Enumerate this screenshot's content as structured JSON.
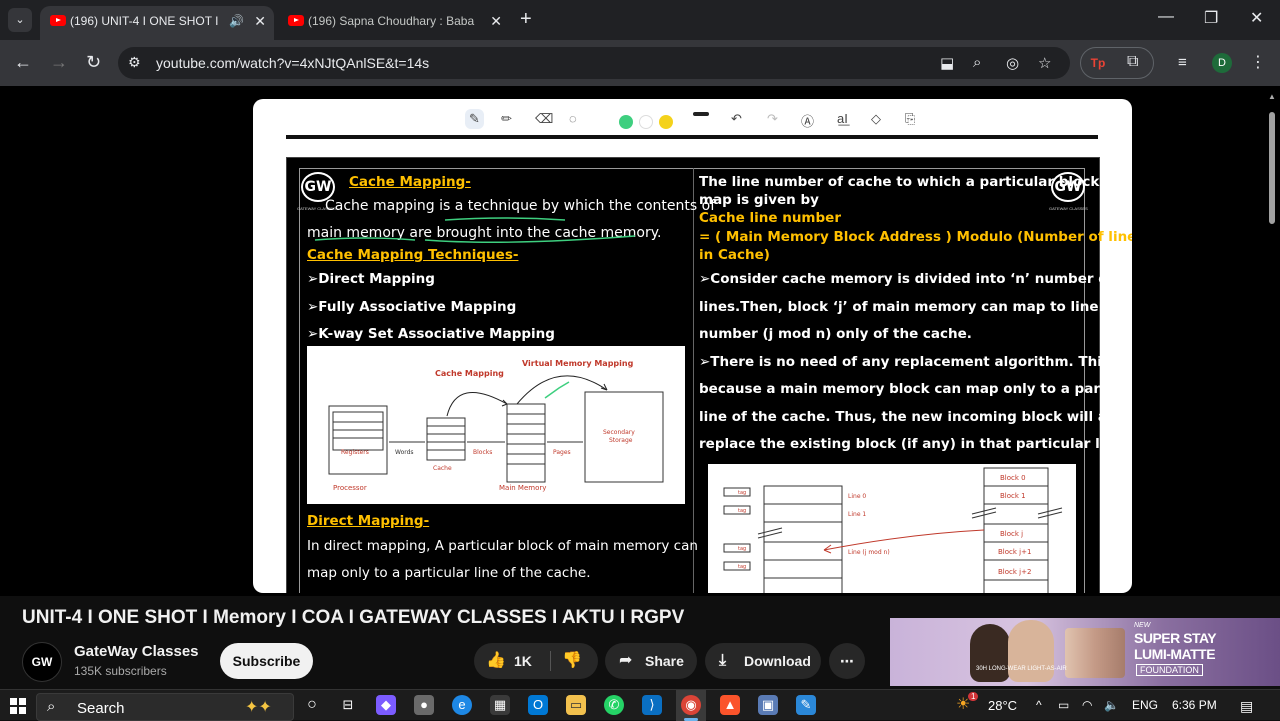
{
  "browser": {
    "tabs": [
      {
        "title": "(196) UNIT-4 I ONE SHOT I",
        "active": true
      },
      {
        "title": "(196) Sapna Choudhary : Baba",
        "active": false
      }
    ],
    "url": "youtube.com/watch?v=4xNJtQAnlSE&t=14s",
    "profile_initial": "D"
  },
  "slide": {
    "left": {
      "heading": "Cache Mapping-",
      "intro_line1": "Cache mapping is a technique by which the contents of",
      "intro_line2": "main memory are brought into the cache memory.",
      "techniques_heading": "Cache Mapping Techniques-",
      "techniques": [
        "➢Direct Mapping",
        "➢Fully Associative Mapping",
        "➢K-way Set Associative Mapping"
      ],
      "direct_heading": "Direct Mapping-",
      "direct_line1": "In direct mapping, A particular block of main memory can",
      "direct_line2": "map only to a particular line of the cache."
    },
    "right": {
      "line1": "The line number of cache to which a particular block can",
      "line2": "map is given by",
      "formula_label": "Cache line number",
      "formula_line1": "= ( Main Memory Block Address ) Modulo (Number of lines",
      "formula_line2": "in Cache)",
      "p1_line1": "➢Consider cache memory is divided into ‘n’ number of",
      "p1_line2": "lines.Then, block ‘j’ of main memory can map to line",
      "p1_line3": "number (j mod n) only of the cache.",
      "p2_line1": "➢There is no need of any replacement algorithm. This is",
      "p2_line2": "because a main memory block can map only to a particular",
      "p2_line3": "line of the cache. Thus, the new incoming block will always",
      "p2_line4": "replace the existing block (if any) in that particular line."
    },
    "logo_text": "GW",
    "logo_sub": "GATEWAY CLASSES",
    "diagram1": {
      "virtual": "Virtual Memory Mapping",
      "cache_mapping": "Cache Mapping",
      "registers": "Registers",
      "words": "Words",
      "blocks": "Blocks",
      "pages": "Pages",
      "secondary": "Secondary",
      "storage": "Storage",
      "cache": "Cache",
      "processor": "Processor",
      "main_memory": "Main Memory"
    },
    "diagram2": {
      "tag": "tag",
      "line0": "Line 0",
      "line1": "Line 1",
      "linej": "Line (j mod n)",
      "block0": "Block 0",
      "block1": "Block 1",
      "blockj": "Block j",
      "blockj1": "Block j+1",
      "blockj2": "Block j+2"
    }
  },
  "video": {
    "title": "UNIT-4 I ONE SHOT I Memory I COA I GATEWAY CLASSES I AKTU I RGPV",
    "channel": "GateWay Classes",
    "subscribers": "135K subscribers",
    "subscribe_label": "Subscribe",
    "likes": "1K",
    "share_label": "Share",
    "download_label": "Download"
  },
  "ad": {
    "new": "NEW",
    "line1": "SUPER STAY",
    "line2": "LUMI-MATTE",
    "line3": "FOUNDATION",
    "small": "30H LONG-WEAR LIGHT-AS-AIR"
  },
  "taskbar": {
    "search_placeholder": "Search",
    "temperature": "28°C",
    "language": "ENG",
    "time": "6:36 PM",
    "weather_badge": "1"
  }
}
